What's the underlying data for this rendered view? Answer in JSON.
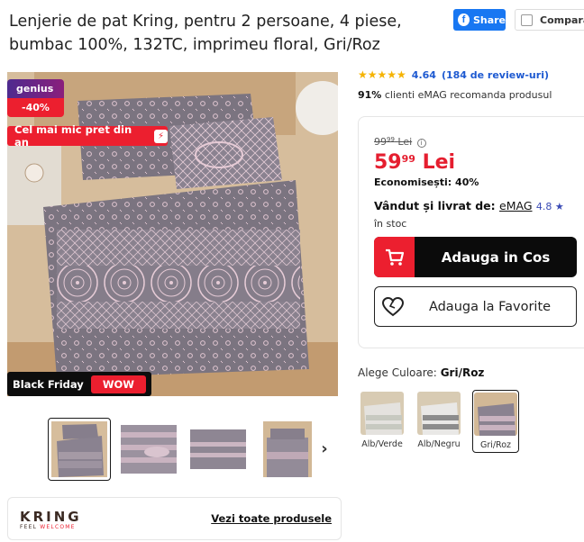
{
  "product": {
    "title": "Lenjerie de pat Kring, pentru 2 persoane, 4 piese, bumbac 100%, 132TC, imprimeu floral, Gri/Roz"
  },
  "actions": {
    "share_label": "Share",
    "compare_label": "Compara"
  },
  "badges": {
    "genius_label": "genius",
    "genius_discount": "-40%",
    "best_price": "Cel mai mic pret din an",
    "black_friday": "Black Friday",
    "wow": "WOW"
  },
  "thumbnails": [
    {
      "alt": "thumb-1",
      "active": true
    },
    {
      "alt": "thumb-2",
      "active": false
    },
    {
      "alt": "thumb-3",
      "active": false
    },
    {
      "alt": "thumb-4",
      "active": false
    }
  ],
  "brand": {
    "name": "KRING",
    "tagline_a": "FEEL ",
    "tagline_b": "WELCOME",
    "link": "Vezi toate produsele"
  },
  "rating": {
    "stars": "★★★★★",
    "value": "4.64",
    "reviews": "(184 de review-uri)",
    "stars_value": 4.64
  },
  "recommend": {
    "percent": "91%",
    "text": " clienti eMAG recomanda produsul"
  },
  "price": {
    "old_int": "99",
    "old_dec": "99",
    "old_currency": "Lei",
    "new_int": "59",
    "new_dec": "99",
    "new_currency": "Lei",
    "savings_label": "Economisești:",
    "savings_value": "40%"
  },
  "seller": {
    "label": "Vândut și livrat de:",
    "name": "eMAG",
    "score": "4.8 ★",
    "stock": "în stoc"
  },
  "buttons": {
    "add_to_cart": "Adauga in Cos",
    "add_to_favorites": "Adauga la Favorite"
  },
  "color_chooser": {
    "label": "Alege Culoare:",
    "selected": "Gri/Roz",
    "options": [
      {
        "name": "Alb/Verde",
        "active": false
      },
      {
        "name": "Alb/Negru",
        "active": false
      },
      {
        "name": "Gri/Roz",
        "active": true
      }
    ]
  },
  "colors": {
    "accent_red": "#ec1f2f",
    "price_red": "#e51e2f",
    "link_blue": "#1e5ad1",
    "star_yellow": "#f5b301",
    "facebook_blue": "#1877f2"
  }
}
